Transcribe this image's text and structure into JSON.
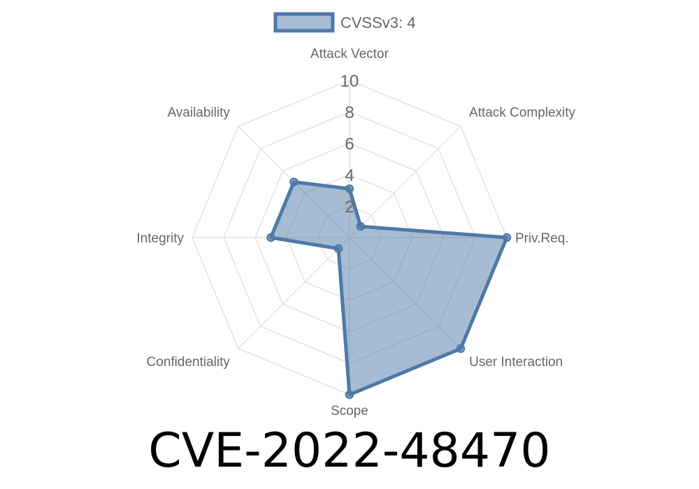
{
  "title": "CVE-2022-48470",
  "chart_data": {
    "type": "radar",
    "title": "CVE-2022-48470",
    "axes": [
      "Attack Vector",
      "Attack Complexity",
      "Priv.Req.",
      "User Interaction",
      "Scope",
      "Confidentiality",
      "Integrity",
      "Availability"
    ],
    "series": [
      {
        "name": "CVSSv3: 4",
        "values": [
          3.1,
          1,
          10,
          10,
          10,
          1,
          5,
          5
        ],
        "stroke": "#4e79a7",
        "fill": "rgba(78,121,167,0.5)"
      }
    ],
    "r_range": [
      0,
      10
    ],
    "r_ticks": [
      2,
      4,
      6,
      8,
      10
    ],
    "r_tick_labels": [
      "2",
      "4",
      "6",
      "8",
      "10"
    ],
    "grid": true,
    "legend": "top-center"
  }
}
